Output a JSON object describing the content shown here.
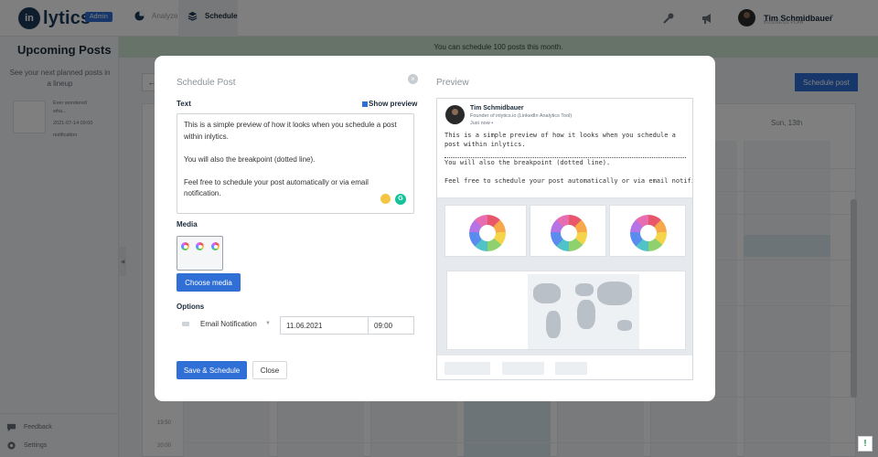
{
  "app": {
    "logo_mark": "in",
    "logo_text": "lytics",
    "admin_badge": "Admin",
    "nav": {
      "analyze": "Analyze",
      "schedule": "Schedule"
    },
    "user": {
      "name": "Tim Schmidbauer",
      "plan": "BUSINESS PLAN"
    }
  },
  "sidebar": {
    "title": "Upcoming Posts",
    "subtitle": "See your next planned posts in a lineup",
    "post": {
      "excerpt_line1": "Ever wondered",
      "excerpt_line2": "wha...",
      "datetime": "2021-07-14 09:00",
      "type": "notification"
    },
    "feedback": "Feedback",
    "settings": "Settings"
  },
  "banner": "You can schedule 100 posts this month.",
  "toolbar": {
    "back": "←",
    "schedule_post": "Schedule post"
  },
  "calendar": {
    "day_label": "Sun, 13th",
    "times": [
      "19:50",
      "20:00"
    ]
  },
  "modal": {
    "title": "Schedule Post",
    "close_glyph": "×",
    "text_label": "Text",
    "show_preview": "Show preview",
    "text_content": "This is a simple preview of how it looks when you schedule a post within inlytics.\n\nYou will also the breakpoint (dotted line).\n\nFeel free to schedule your post automatically or via email notification.",
    "grammarly": "G",
    "media_label": "Media",
    "choose_media": "Choose media",
    "options_label": "Options",
    "notification_type": "Email Notification",
    "date": "11.06.2021",
    "time": "09:00",
    "save": "Save & Schedule",
    "close": "Close"
  },
  "preview": {
    "title": "Preview",
    "author": "Tim Schmidbauer",
    "role": "Founder of inlytics.io (LinkedIn Analytics Tool)",
    "time": "Just now •",
    "line1": "This is a simple preview of how it looks when you schedule a post within inlytics.",
    "line2": "You will also the breakpoint (dotted line).",
    "line3": "Feel free to schedule your post automatically or via email notification."
  },
  "icons": [
    "analyze-icon",
    "schedule-icon",
    "wrench-icon",
    "megaphone-icon",
    "chevron-down-icon",
    "feedback-icon",
    "settings-icon",
    "close-icon",
    "help-icon"
  ],
  "colors": {
    "accent": "#2f6fd6",
    "banner": "#cfe6d3",
    "brand": "#1b3a5c"
  }
}
